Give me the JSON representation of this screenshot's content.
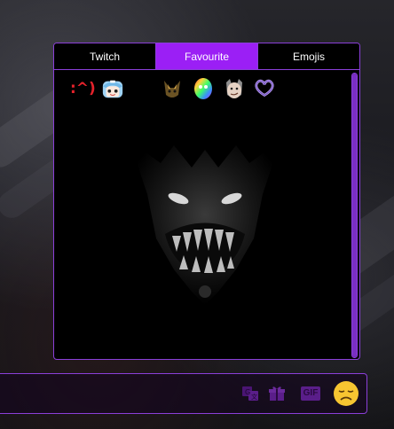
{
  "picker": {
    "tabs": [
      {
        "label": "Twitch",
        "active": false
      },
      {
        "label": "Favourite",
        "active": true
      },
      {
        "label": "Emojis",
        "active": false
      }
    ],
    "emotes": [
      {
        "name": ":^)",
        "kind": "text"
      },
      {
        "name": "anime-girl-emote",
        "kind": "image"
      },
      {
        "name": "cat-ears-emote",
        "kind": "image"
      },
      {
        "name": "rainbow-blob-emote",
        "kind": "image"
      },
      {
        "name": "smirk-face-emote",
        "kind": "image"
      },
      {
        "name": "heart-hands-emote",
        "kind": "image"
      }
    ]
  },
  "chat": {
    "placeholder": "",
    "buttons": {
      "gif_label": "GIF"
    }
  },
  "colors": {
    "accent": "#9b1ff5",
    "border": "#8b3fd9",
    "emoji_yellow": "#f7c531"
  }
}
